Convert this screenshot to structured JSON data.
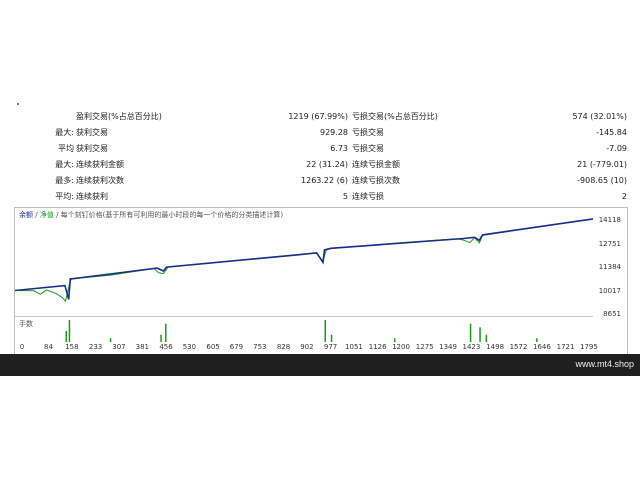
{
  "stats_rows": [
    {
      "c1": "",
      "c2": "盈利交易(%占总百分比)",
      "c3": "1219 (67.99%)",
      "c4": "亏损交易(%占总百分比)",
      "c5": "574 (32.01%)"
    },
    {
      "c1": "最大:",
      "c2": "获利交易",
      "c3": "929.28",
      "c4": "亏损交易",
      "c5": "-145.84"
    },
    {
      "c1": "平均",
      "c2": "获利交易",
      "c3": "6.73",
      "c4": "亏损交易",
      "c5": "-7.09"
    },
    {
      "c1": "最大:",
      "c2": "连续获利金额",
      "c3": "22 (31.24)",
      "c4": "连续亏损金额",
      "c5": "21 (-779.01)"
    },
    {
      "c1": "最多:",
      "c2": "连续获利次数",
      "c3": "1263.22 (6)",
      "c4": "连续亏损次数",
      "c5": "-908.65 (10)"
    },
    {
      "c1": "平均:",
      "c2": "连续获利",
      "c3": "5",
      "c4": "连续亏损",
      "c5": "2"
    }
  ],
  "chart": {
    "legend_balance": "余额",
    "legend_separator": "/",
    "legend_equity": "净值",
    "legend_desc": "/ 每个刻钉价格(基于所有可利用的最小时段的每一个价格的分类描述计算)",
    "volume_label": "手数",
    "colors": {
      "balance": "#1a2d8a",
      "equity": "#1a9a1a",
      "volume": "#1a9a1a"
    }
  },
  "chart_data": {
    "type": "line",
    "x_ticks": [
      "0",
      "84",
      "158",
      "233",
      "307",
      "381",
      "456",
      "530",
      "605",
      "679",
      "753",
      "828",
      "902",
      "977",
      "1051",
      "1126",
      "1200",
      "1275",
      "1349",
      "1423",
      "1498",
      "1572",
      "1646",
      "1721",
      "1795"
    ],
    "y_ticks": [
      "14118",
      "12751",
      "11384",
      "10017",
      "8651"
    ],
    "ylim": [
      8651,
      14118
    ],
    "xlim": [
      0,
      1830
    ],
    "series": [
      {
        "name": "余额",
        "x": [
          0,
          158,
          170,
          175,
          180,
          450,
          470,
          480,
          900,
          955,
          975,
          980,
          1000,
          1420,
          1455,
          1470,
          1480,
          1830
        ],
        "y": [
          10017,
          10300,
          9500,
          10700,
          10700,
          11320,
          11150,
          11380,
          12100,
          12210,
          11650,
          12380,
          12470,
          13040,
          13110,
          12930,
          13250,
          14180
        ]
      },
      {
        "name": "净值",
        "x": [
          0,
          60,
          80,
          100,
          130,
          150,
          160,
          175,
          180,
          300,
          440,
          455,
          470,
          485,
          700,
          880,
          955,
          975,
          985,
          1000,
          1200,
          1400,
          1420,
          1440,
          1455,
          1470,
          1480,
          1600,
          1830
        ],
        "y": [
          10017,
          10000,
          9800,
          10050,
          9850,
          9600,
          9400,
          10620,
          10700,
          10900,
          11300,
          11050,
          11000,
          11380,
          11760,
          12080,
          12190,
          11700,
          12360,
          12460,
          12760,
          13030,
          12950,
          12800,
          13090,
          12780,
          13220,
          13560,
          14180
        ]
      }
    ],
    "volume": {
      "x": [
        160,
        170,
        300,
        460,
        475,
        980,
        1000,
        1200,
        1440,
        1470,
        1490,
        1650
      ],
      "y": [
        3,
        6,
        1,
        2,
        5,
        6,
        2,
        1,
        5,
        4,
        2,
        1
      ]
    }
  },
  "watermark": "www.mt4.shop"
}
